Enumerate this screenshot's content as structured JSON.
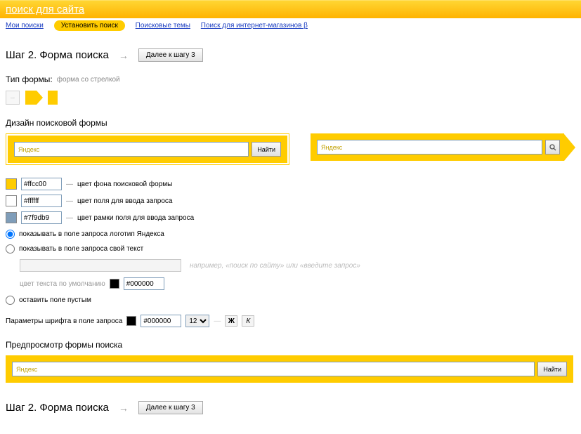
{
  "header": {
    "title": "поиск для сайта"
  },
  "nav": {
    "items": [
      {
        "label": "Мои поиски",
        "active": false
      },
      {
        "label": "Установить поиск",
        "active": true
      },
      {
        "label": "Поисковые темы",
        "active": false
      },
      {
        "label": "Поиск для интернет-магазинов β",
        "active": false
      }
    ]
  },
  "step": {
    "title": "Шаг 2. Форма поиска",
    "next_button": "Далее к шагу 3"
  },
  "form_type": {
    "label": "Тип формы:",
    "value": "форма со стрелкой"
  },
  "design_title": "Дизайн поисковой формы",
  "preview": {
    "placeholder": "Яндекс",
    "search_btn": "Найти"
  },
  "colors": {
    "bg": {
      "hex": "#ffcc00",
      "label": "цвет фона поисковой формы"
    },
    "field": {
      "hex": "#ffffff",
      "label": "цвет поля для ввода запроса"
    },
    "border": {
      "hex": "#7f9db9",
      "label": "цвет рамки поля для ввода запроса"
    }
  },
  "radio": {
    "logo": "показывать в поле запроса логотип Яндекса",
    "custom": "показывать в поле запроса свой текст",
    "custom_hint": "например, «поиск по сайту» или «введите запрос»",
    "default_color_label": "цвет текста по умолчанию",
    "default_color_hex": "#000000",
    "empty": "оставить поле пустым"
  },
  "font": {
    "label": "Параметры шрифта в поле запроса",
    "color_hex": "#000000",
    "size": "12",
    "bold": "Ж",
    "italic": "К"
  },
  "preview_title": "Предпросмотр формы поиска"
}
